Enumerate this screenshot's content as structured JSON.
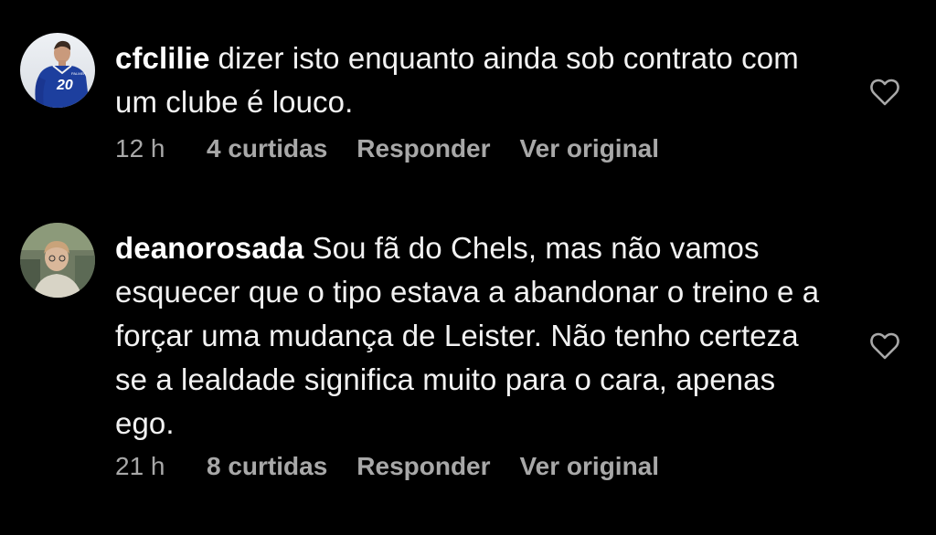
{
  "comments": [
    {
      "username": "cfclilie",
      "text": "dizer isto enquanto ainda sob contrato com um clube é louco.",
      "time": "12 h",
      "likes": "4 curtidas",
      "reply_label": "Responder",
      "see_original_label": "Ver original",
      "avatar_icon": "avatar-football-player-number-20",
      "jersey_number": "20",
      "jersey_color": "#1d3f9e"
    },
    {
      "username": "deanorosada",
      "text": "Sou fã do Chels, mas não vamos esquecer que o tipo estava a abandonar o treino e a forçar uma mudança de Leister. Não tenho certeza se a lealdade significa muito para o cara, apenas ego.",
      "time": "21 h",
      "likes": "8 curtidas",
      "reply_label": "Responder",
      "see_original_label": "Ver original",
      "avatar_icon": "avatar-person-photo"
    }
  ],
  "like_icon": "heart-outline-icon",
  "colors": {
    "background": "#000000",
    "text": "#f2f2f2",
    "meta": "#a8a8a8"
  }
}
